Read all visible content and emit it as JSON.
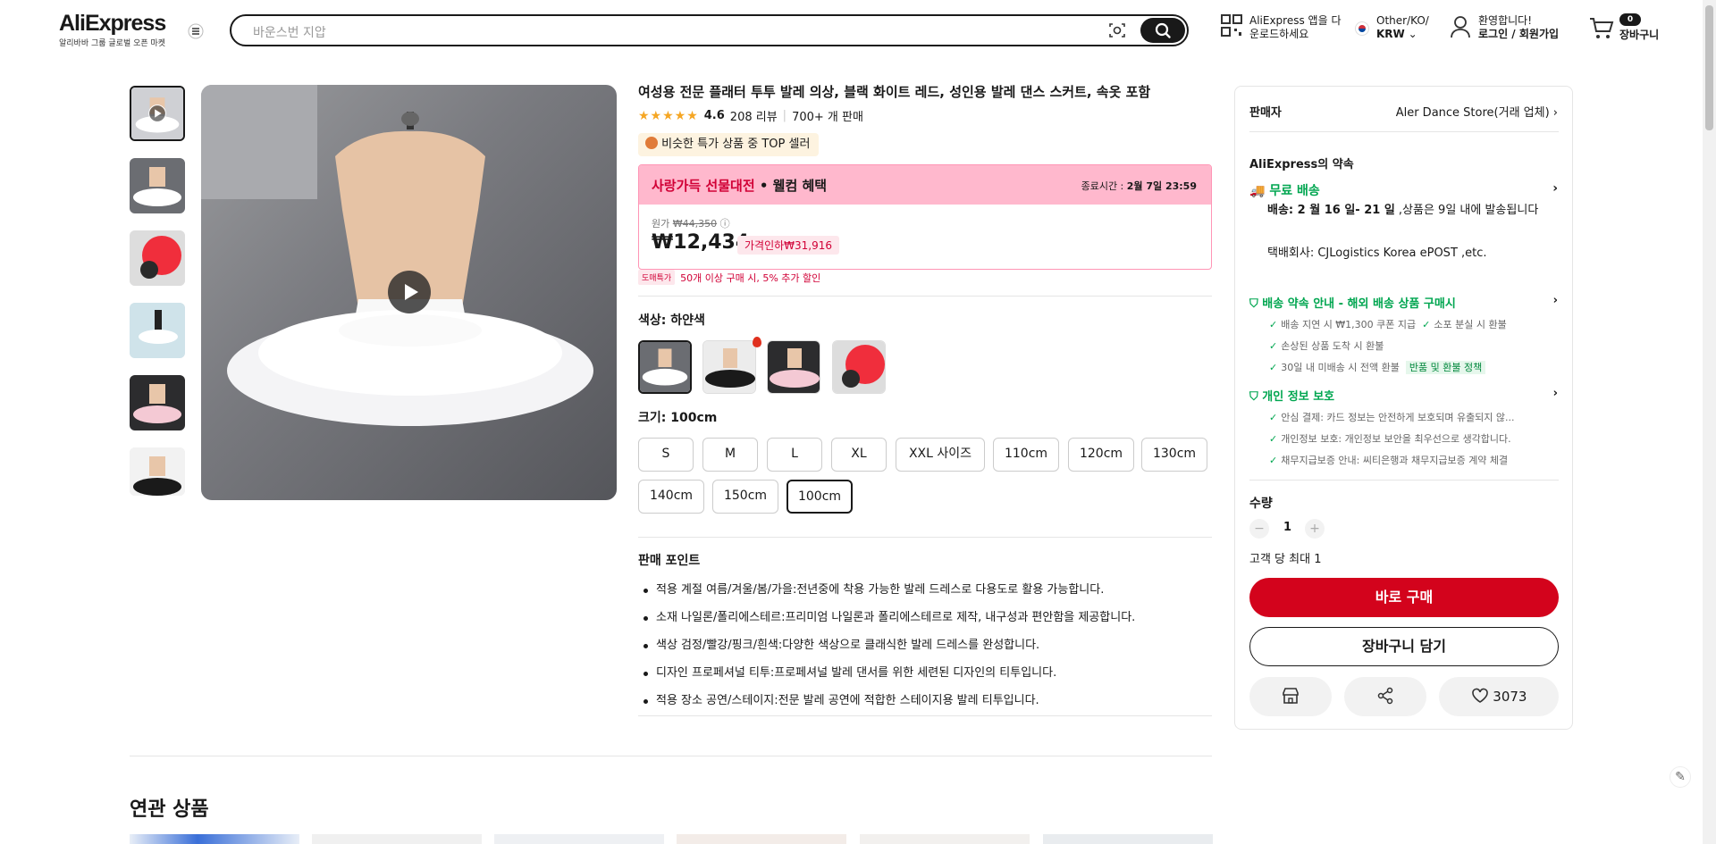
{
  "header": {
    "logo": "AliExpress",
    "logo_sub": "알리바바 그룹 글로벌 오픈 마켓",
    "search_placeholder": "바운스번 지압",
    "app_line1": "AliExpress 앱을 다",
    "app_line2": "운로드하세요",
    "region_line1": "Other/KO/",
    "region_line2": "KRW",
    "account_line1": "환영합니다!",
    "account_line2": "로그인 / 회원가입",
    "cart_count": "0",
    "cart_label": "장바구니"
  },
  "product": {
    "title": "여성용 전문 플래터 투투 발레 의상, 블랙 화이트 레드, 성인용 발레 댄스 스커트, 속옷 포함",
    "rating": "4.6",
    "reviews": "208 리뷰",
    "sold": "700+ 개 판매",
    "top_badge": "비슷한 특가 상품 중 TOP 셀러",
    "promo_title_red": "사랑가득 선물대전",
    "promo_title_rest": " • 웰컴 혜택",
    "promo_time_label": "종료시간 :",
    "promo_time": "2월 7일 23:59",
    "orig_label": "원가",
    "orig_price": "₩44,350",
    "price": "₩12,434",
    "discount": "가격인하₩31,916",
    "bulk_tag": "도매특가",
    "bulk_text": "50개 이상 구매 시, 5% 추가 할인",
    "color_label": "색상: 하얀색",
    "size_label": "크기: 100cm",
    "sizes": [
      "S",
      "M",
      "L",
      "XL",
      "XXL 사이즈",
      "110cm",
      "120cm",
      "130cm",
      "140cm",
      "150cm",
      "100cm"
    ],
    "selling_points_title": "판매 포인트",
    "selling_points": [
      "적용 계절  여름/겨울/봄/가을:전년중에 착용 가능한 발레 드레스로 다용도로 활용 가능합니다.",
      "소재  나일론/폴리에스테르:프리미엄 나일론과 폴리에스테르로 제작, 내구성과 편안함을 제공합니다.",
      "색상  검정/빨강/핑크/흰색:다양한 색상으로 클래식한 발레 드레스를 완성합니다.",
      "디자인  프로페셔널 티투:프로페셔널 발레 댄서를 위한 세련된 디자인의 티투입니다.",
      "적용 장소  공연/스테이지:전문 발레 공연에 적합한 스테이지용 발레 티투입니다."
    ]
  },
  "sidebar": {
    "seller_label": "판매자",
    "seller_name": "Aler Dance Store(거래 업체)",
    "promise_title": "AliExpress의 약속",
    "free_shipping": "무료 배송",
    "delivery": "배송: 2 월 16 일- 21 일",
    "delivery_rest": " ,상품은 9일 내에 발송됩니다",
    "carrier": "택배회사:   CJLogistics   Korea ePOST ,etc.",
    "guarantee_title": "배송 약속 안내 - 해외 배송 상품 구매시",
    "guarantee_1": "배송 지연 시 ₩1,300 쿠폰 지급",
    "guarantee_2": "소포 분실 시 환불",
    "guarantee_3": "손상된 상품 도착 시 환불",
    "guarantee_4": "30일 내 미배송 시 전액 환불",
    "guarantee_tag": "반품 및 환불 정책",
    "privacy_title": "개인 정보 보호",
    "privacy_1": "안심 결제: 카드 정보는 안전하게 보호되며 유출되지 않...",
    "privacy_2": "개인정보 보호: 개인정보 보안을 최우선으로 생각합니다.",
    "privacy_3": "채무지급보증 안내: 씨티은행과 채무지급보증 계약 체결",
    "qty_label": "수량",
    "qty_value": "1",
    "max_label": "고객 당 최대 1",
    "buy_now": "바로 구매",
    "add_cart": "장바구니 담기",
    "wish_count": "3073"
  },
  "related_title": "연관 상품",
  "colors": {
    "brand_red": "#d3031c",
    "promo_pink": "#ffb8cd",
    "green": "#00a650",
    "star": "#f5a623"
  }
}
